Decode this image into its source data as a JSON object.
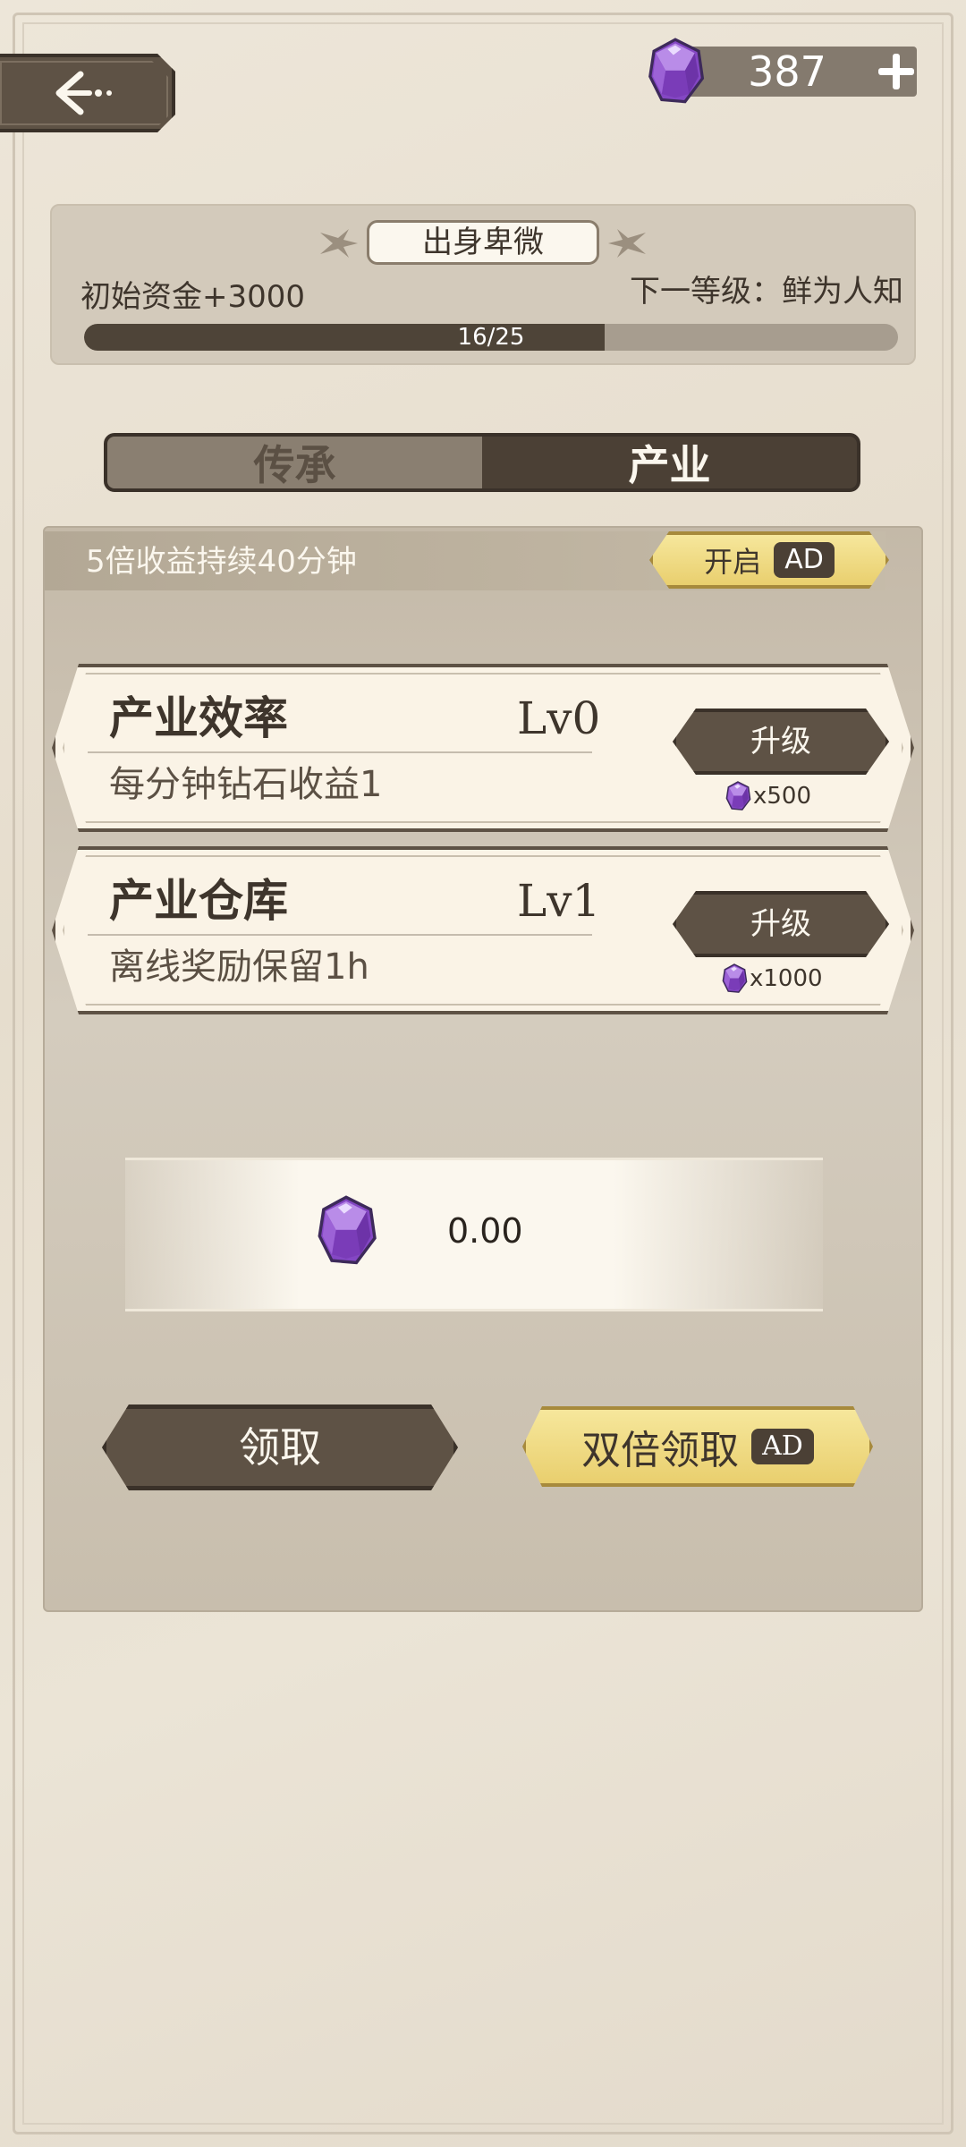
{
  "header": {
    "back_label": "",
    "currency_value": "387"
  },
  "rank": {
    "title": "出身卑微",
    "bonus": "初始资金+3000",
    "next_level": "下一等级：鲜为人知",
    "progress_text": "16/25",
    "progress_fraction": 0.64
  },
  "tabs": [
    {
      "label": "传承",
      "active": false
    },
    {
      "label": "产业",
      "active": true
    }
  ],
  "boost": {
    "text": "5倍收益持续40分钟",
    "button_label": "开启",
    "ad_label": "AD"
  },
  "cards": [
    {
      "title": "产业效率",
      "level": "Lv0",
      "desc": "每分钟钻石收益1",
      "upgrade_label": "升级",
      "cost": "x500"
    },
    {
      "title": "产业仓库",
      "level": "Lv1",
      "desc": "离线奖励保留1h",
      "upgrade_label": "升级",
      "cost": "x1000"
    }
  ],
  "reward": {
    "value": "0.00"
  },
  "actions": {
    "claim_label": "领取",
    "double_claim_label": "双倍领取",
    "ad_label": "AD"
  },
  "icons": {
    "gem": "gem-icon",
    "back": "back-arrow-icon",
    "plus": "plus-icon"
  },
  "colors": {
    "dark_brown": "#5e5245",
    "gold": "#e9cf6e",
    "gem_purple": "#9a5ad2"
  }
}
